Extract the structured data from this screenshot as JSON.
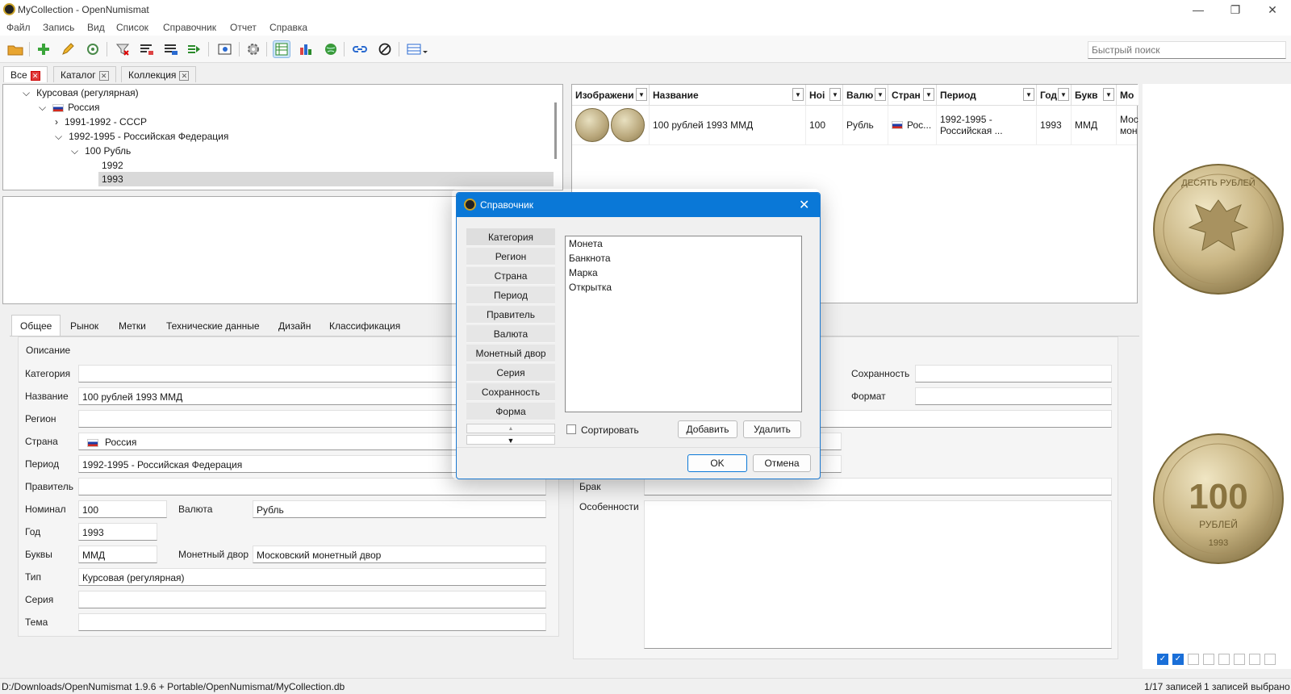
{
  "window": {
    "title": "MyCollection - OpenNumismat",
    "minimize": "—",
    "maximize": "❐",
    "close": "✕"
  },
  "menu": [
    "Файл",
    "Запись",
    "Вид",
    "Список",
    "Справочник",
    "Отчет",
    "Справка"
  ],
  "toolbar": {
    "quick_search_placeholder": "Быстрый поиск"
  },
  "filter_tabs": [
    {
      "label": "Все"
    },
    {
      "label": "Каталог"
    },
    {
      "label": "Коллекция"
    }
  ],
  "tree": {
    "root": "Курсовая (регулярная)",
    "country": "Россия",
    "period1": "1991-1992 - СССР",
    "period2": "1992-1995 - Российская Федерация",
    "value": "100 Рубль",
    "year1": "1992",
    "year2": "1993"
  },
  "grid": {
    "headers": [
      "Изображени",
      "Название",
      "Ноі",
      "Валю",
      "Стран",
      "Период",
      "Год",
      "Букв",
      "Мо"
    ],
    "row": {
      "name": "100 рублей 1993 ММД",
      "value": "100",
      "currency": "Рубль",
      "country": "Рос...",
      "period_line1": "1992-1995 -",
      "period_line2": "Российская ...",
      "year": "1993",
      "mint": "ММД",
      "mintmark_line1": "Мос",
      "mintmark_line2": "мон"
    }
  },
  "detail_tabs": [
    "Общее",
    "Рынок",
    "Метки",
    "Технические данные",
    "Дизайн",
    "Классификация"
  ],
  "description": {
    "title": "Описание",
    "fields": {
      "category": {
        "label": "Категория",
        "value": ""
      },
      "name": {
        "label": "Название",
        "value": "100 рублей 1993 ММД"
      },
      "region": {
        "label": "Регион",
        "value": ""
      },
      "country": {
        "label": "Страна",
        "value": "Россия"
      },
      "period": {
        "label": "Период",
        "value": "1992-1995 - Российская Федерация"
      },
      "ruler": {
        "label": "Правитель",
        "value": ""
      },
      "denomination": {
        "label": "Номинал",
        "value": "100"
      },
      "currency": {
        "label": "Валюта",
        "value": "Рубль"
      },
      "year": {
        "label": "Год",
        "value": "1993"
      },
      "mintmark": {
        "label": "Буквы",
        "value": "ММД"
      },
      "mint": {
        "label": "Монетный двор",
        "value": "Московский монетный двор"
      },
      "type": {
        "label": "Тип",
        "value": "Курсовая (регулярная)"
      },
      "series": {
        "label": "Серия",
        "value": ""
      },
      "theme": {
        "label": "Тема",
        "value": ""
      }
    }
  },
  "right_fields": {
    "grade": {
      "label": "Сохранность",
      "value": ""
    },
    "format": {
      "label": "Формат",
      "value": ""
    },
    "defect": {
      "label": "Брак",
      "value": ""
    },
    "features": {
      "label": "Особенности",
      "value": ""
    }
  },
  "image_panel": {
    "obverse_legend": "ДЕСЯТЬ РУБЛЕЙ",
    "reverse_value": "100",
    "reverse_unit": "РУБЛЕЙ",
    "reverse_year": "1993"
  },
  "thumbs": [
    true,
    true,
    false,
    false,
    false,
    false,
    false,
    false
  ],
  "statusbar": {
    "path": "D:/Downloads/OpenNumismat 1.9.6 + Portable/OpenNumismat/MyCollection.db",
    "records": "1/17 записей",
    "selected": "1 записей выбрано"
  },
  "dialog": {
    "title": "Справочник",
    "close": "✕",
    "categories": [
      "Категория",
      "Регион",
      "Страна",
      "Период",
      "Правитель",
      "Валюта",
      "Монетный двор",
      "Серия",
      "Сохранность",
      "Форма"
    ],
    "items": [
      "Монета",
      "Банкнота",
      "Марка",
      "Открытка"
    ],
    "sort_label": "Сортировать",
    "add_button": "Добавить",
    "delete_button": "Удалить",
    "ok_button": "OK",
    "cancel_button": "Отмена",
    "scroll_up": "▲",
    "scroll_down": "▼"
  },
  "colors": {
    "accent": "#0a78d7",
    "selection": "#cce4f7",
    "tree_selected": "#d9d9d9"
  }
}
